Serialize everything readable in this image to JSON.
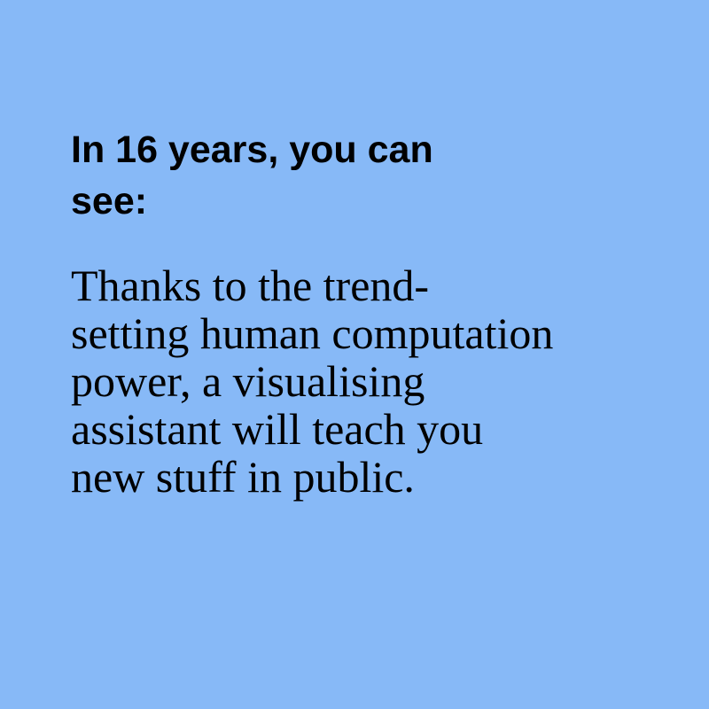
{
  "background_color": "#87b9f7",
  "text_color": "#000000",
  "heading": {
    "lines": [
      "In 16 years, you can",
      "see:"
    ]
  },
  "body": {
    "lines": [
      "Thanks to the trend-",
      "setting human computation",
      "power, a visualising",
      "assistant will teach you",
      "new stuff in public."
    ]
  }
}
